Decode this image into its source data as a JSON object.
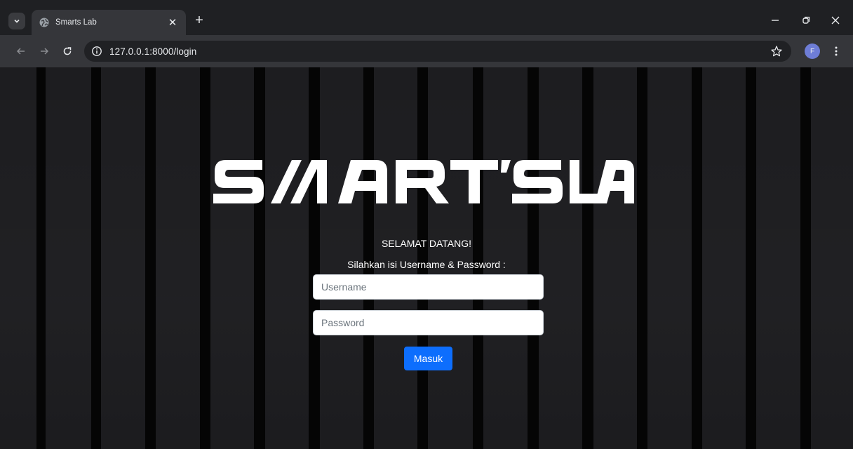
{
  "browser": {
    "tab_title": "Smarts Lab",
    "url": "127.0.0.1:8000/login",
    "profile_initial": "F",
    "profile_color": "#6e7dd6",
    "icons": [
      "tab-search-icon",
      "globe-favicon-icon",
      "close-tab-icon",
      "new-tab-icon",
      "minimize-icon",
      "restore-icon",
      "close-window-icon",
      "back-icon",
      "forward-icon",
      "reload-icon",
      "site-info-icon",
      "bookmark-star-icon",
      "menu-icon"
    ]
  },
  "page": {
    "logo_text": "SMARTS LAB",
    "welcome": "SELAMAT DATANG!",
    "instruction": "Silahkan isi Username & Password :",
    "username": {
      "placeholder": "Username",
      "value": ""
    },
    "password": {
      "placeholder": "Password",
      "value": ""
    },
    "submit_label": "Masuk",
    "colors": {
      "background": "#1d1d20",
      "stripe": "#050505",
      "button": "#0d6efd",
      "logo": "#ffffff"
    }
  }
}
